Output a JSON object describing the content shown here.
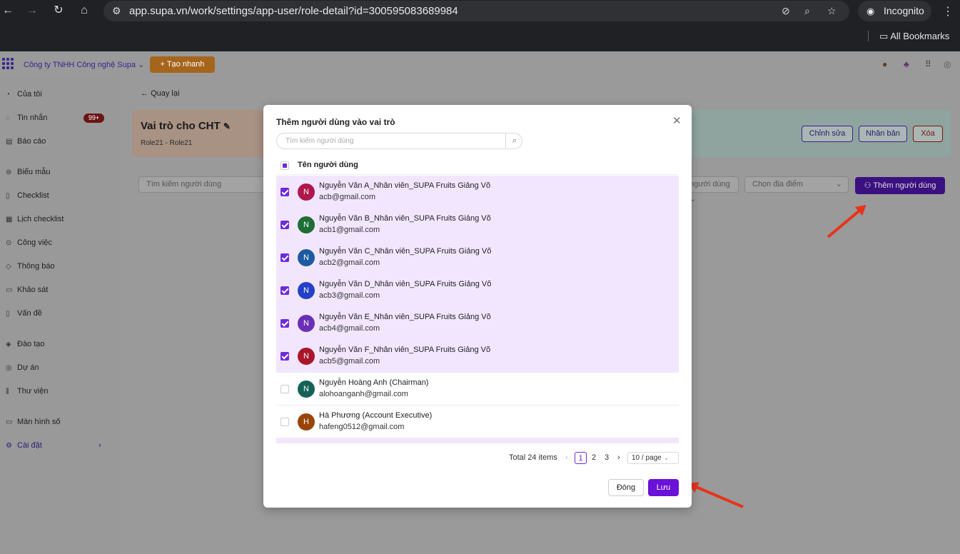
{
  "browser": {
    "url": "app.supa.vn/work/settings/app-user/role-detail?id=300595083689984",
    "incognito_label": "Incognito",
    "bookmarks_label": "All Bookmarks"
  },
  "topbar": {
    "company": "Công ty TNHH Công nghệ Supa",
    "quick_create": "Tạo nhanh"
  },
  "sidebar": {
    "items": [
      {
        "label": "Của tôi",
        "icon": "person-icon"
      },
      {
        "label": "Tin nhắn",
        "icon": "chat-icon",
        "badge": "99+"
      },
      {
        "label": "Báo cáo",
        "icon": "report-icon"
      },
      {
        "label": "Biểu mẫu",
        "icon": "form-icon"
      },
      {
        "label": "Checklist",
        "icon": "checklist-icon"
      },
      {
        "label": "Lịch checklist",
        "icon": "calendar-icon"
      },
      {
        "label": "Công việc",
        "icon": "task-icon"
      },
      {
        "label": "Thông báo",
        "icon": "bell-icon"
      },
      {
        "label": "Khảo sát",
        "icon": "survey-icon"
      },
      {
        "label": "Vấn đề",
        "icon": "issue-icon"
      },
      {
        "label": "Đào tạo",
        "icon": "training-icon"
      },
      {
        "label": "Dự án",
        "icon": "project-icon"
      },
      {
        "label": "Thư viện",
        "icon": "library-icon"
      },
      {
        "label": "Màn hình số",
        "icon": "monitor-icon"
      },
      {
        "label": "Cài đặt",
        "icon": "settings-icon"
      }
    ]
  },
  "page": {
    "back": "Quay lại",
    "role_title": "Vai trò cho CHT",
    "role_sub": "Role21 - Role21",
    "actions": {
      "edit": "Chỉnh sửa",
      "duplicate": "Nhân bản",
      "delete": "Xóa"
    },
    "search_placeholder": "Tìm kiếm người dùng",
    "user_filter": "người dùng",
    "location_placeholder": "Chọn địa điểm",
    "add_user": "Thêm người dùng"
  },
  "modal": {
    "title": "Thêm người dùng vào vai trò",
    "search_placeholder": "Tìm kiếm người dùng",
    "column_header": "Tên người dùng",
    "users": [
      {
        "initial": "N",
        "name": "Nguyễn Văn A_Nhân viên_SUPA Fruits Giảng Võ",
        "email": "acb@gmail.com",
        "checked": true,
        "color": "#b0174a"
      },
      {
        "initial": "N",
        "name": "Nguyễn Văn B_Nhân viên_SUPA Fruits Giảng Võ",
        "email": "acb1@gmail.com",
        "checked": true,
        "color": "#1f6e35"
      },
      {
        "initial": "N",
        "name": "Nguyễn Văn C_Nhân viên_SUPA Fruits Giảng Võ",
        "email": "acb2@gmail.com",
        "checked": true,
        "color": "#1e5aa0"
      },
      {
        "initial": "N",
        "name": "Nguyễn Văn D_Nhân viên_SUPA Fruits Giảng Võ",
        "email": "acb3@gmail.com",
        "checked": true,
        "color": "#2440c8"
      },
      {
        "initial": "N",
        "name": "Nguyễn Văn E_Nhân viên_SUPA Fruits Giảng Võ",
        "email": "acb4@gmail.com",
        "checked": true,
        "color": "#6a2fb8"
      },
      {
        "initial": "N",
        "name": "Nguyễn Văn F_Nhân viên_SUPA Fruits Giảng Võ",
        "email": "acb5@gmail.com",
        "checked": true,
        "color": "#a9162a"
      },
      {
        "initial": "N",
        "name": "Nguyễn Hoàng Anh (Chairman)",
        "email": "alohoanganh@gmail.com",
        "checked": false,
        "color": "#146257"
      },
      {
        "initial": "H",
        "name": "Hà Phương (Account Executive)",
        "email": "hafeng0512@gmail.com",
        "checked": false,
        "color": "#9a4408"
      }
    ],
    "pagination": {
      "total": "Total 24 items",
      "pages": [
        "1",
        "2",
        "3"
      ],
      "current": "1",
      "page_size": "10 / page"
    },
    "close_label": "Đóng",
    "save_label": "Lưu"
  },
  "colors": {
    "accent": "#6a12d8",
    "arrow": "#e8331b"
  }
}
